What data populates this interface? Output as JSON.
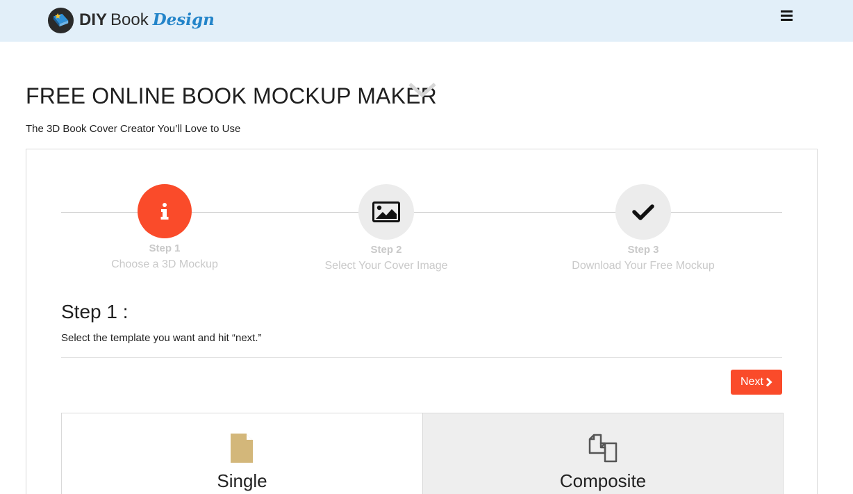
{
  "header": {
    "logo": {
      "part1": "DIY",
      "part2": "Book",
      "part3": "Design"
    },
    "menu_icon": "hamburger-menu-icon"
  },
  "page": {
    "title": "FREE ONLINE BOOK MOCKUP MAKER",
    "subtitle": "The 3D Book Cover Creator You’ll Love to Use"
  },
  "wizard": {
    "steps": [
      {
        "label": "Step 1",
        "desc": "Choose a 3D Mockup",
        "icon": "info-icon",
        "active": true
      },
      {
        "label": "Step 2",
        "desc": "Select Your Cover Image",
        "icon": "image-icon",
        "active": false
      },
      {
        "label": "Step 3",
        "desc": "Download Your Free Mockup",
        "icon": "checkmark-icon",
        "active": false
      }
    ],
    "current_heading": "Step 1 :",
    "instruction": "Select the template you want and hit “next.”",
    "next_label": "Next"
  },
  "templates": [
    {
      "label": "Single",
      "icon": "single-document-icon",
      "selected": true
    },
    {
      "label": "Composite",
      "icon": "composite-documents-icon",
      "selected": false
    }
  ],
  "colors": {
    "header_bg": "#e2eff9",
    "accent": "#fa4b2a",
    "logo_blue": "#2384c9",
    "step_inactive_bg": "#ececec",
    "step_text": "#c9c9c9",
    "single_icon": "#d3b77a"
  }
}
